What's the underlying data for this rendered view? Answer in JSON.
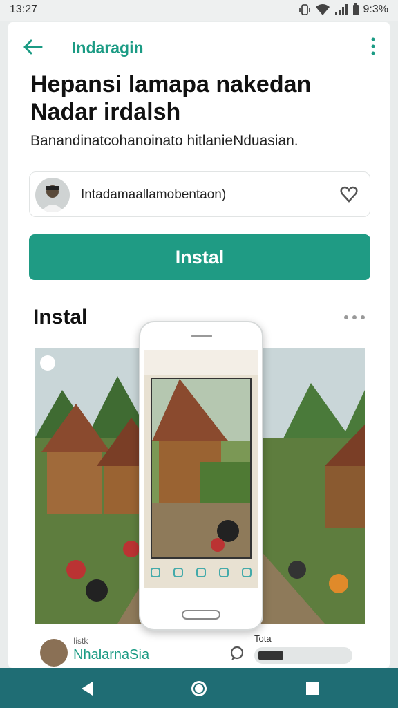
{
  "status": {
    "time": "13:27",
    "battery": "9:3%"
  },
  "topbar": {
    "app_name": "Indaragin"
  },
  "headline": "Hepansi lamapa nakedan Nadar irdalsh",
  "subline": "Banandinatcohanoinato hitlanieNduasian.",
  "account": {
    "name": "Intadamaallamobentaon)"
  },
  "install_button": "Instal",
  "section": {
    "title": "Instal"
  },
  "bottom_left": {
    "label": "Iistk",
    "name": "NhalarnaSia"
  },
  "bottom_right": {
    "label": "Tota",
    "progress": 0.25
  },
  "colors": {
    "accent": "#1f9b84",
    "navbar": "#1f6d74"
  }
}
